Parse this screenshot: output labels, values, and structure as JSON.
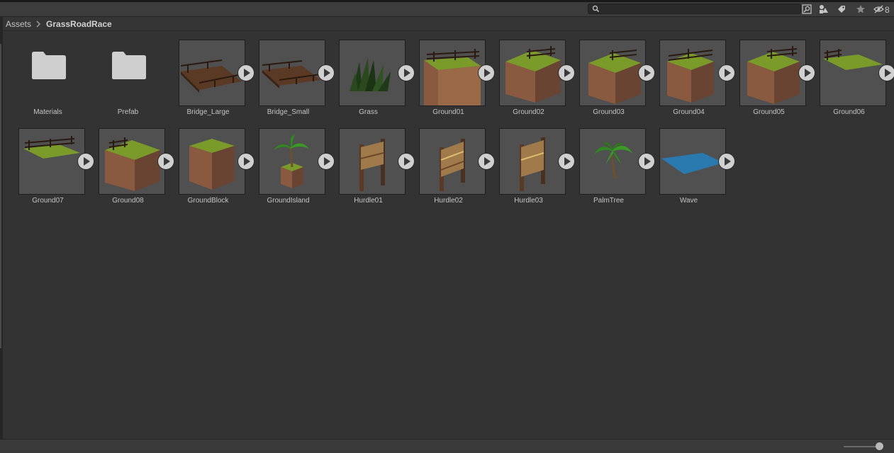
{
  "toolbar": {
    "search": {
      "value": "",
      "placeholder": ""
    },
    "hidden_packages_count": "8",
    "icons": [
      "search-icon",
      "search-by-type-icon",
      "filter-by-label-icon",
      "favorites-star-icon",
      "hidden-eye-icon"
    ]
  },
  "breadcrumb": {
    "items": [
      "Assets",
      "GrassRoadRace"
    ]
  },
  "assets": [
    {
      "name": "Materials",
      "kind": "folder"
    },
    {
      "name": "Prefab",
      "kind": "folder"
    },
    {
      "name": "Bridge_Large",
      "kind": "prefab",
      "preview": "bridge-large"
    },
    {
      "name": "Bridge_Small",
      "kind": "prefab",
      "preview": "bridge-small"
    },
    {
      "name": "Grass",
      "kind": "prefab",
      "preview": "grass"
    },
    {
      "name": "Ground01",
      "kind": "prefab",
      "preview": "ground-fence"
    },
    {
      "name": "Ground02",
      "kind": "prefab",
      "preview": "ground-fence"
    },
    {
      "name": "Ground03",
      "kind": "prefab",
      "preview": "ground-fence-half"
    },
    {
      "name": "Ground04",
      "kind": "prefab",
      "preview": "ground-cube-fence"
    },
    {
      "name": "Ground05",
      "kind": "prefab",
      "preview": "ground-fence-half"
    },
    {
      "name": "Ground06",
      "kind": "prefab",
      "preview": "grass-plane-fence"
    },
    {
      "name": "Ground07",
      "kind": "prefab",
      "preview": "grass-plane-fence"
    },
    {
      "name": "Ground08",
      "kind": "prefab",
      "preview": "ground-fence"
    },
    {
      "name": "GroundBlock",
      "kind": "prefab",
      "preview": "ground-block"
    },
    {
      "name": "GroundIsland",
      "kind": "prefab",
      "preview": "ground-island"
    },
    {
      "name": "Hurdle01",
      "kind": "prefab",
      "preview": "hurdle"
    },
    {
      "name": "Hurdle02",
      "kind": "prefab",
      "preview": "hurdle"
    },
    {
      "name": "Hurdle03",
      "kind": "prefab",
      "preview": "hurdle"
    },
    {
      "name": "PalmTree",
      "kind": "prefab",
      "preview": "palm-tree"
    },
    {
      "name": "Wave",
      "kind": "prefab",
      "preview": "water-plane"
    }
  ],
  "zoom_slider": {
    "value": 0.9
  },
  "colors": {
    "background": "#333333",
    "thumbnail": "#505050",
    "grass": "#7a9a2a",
    "brick": "#8a5a40",
    "wood": "#5a3a24",
    "water": "#2a7ab0"
  }
}
